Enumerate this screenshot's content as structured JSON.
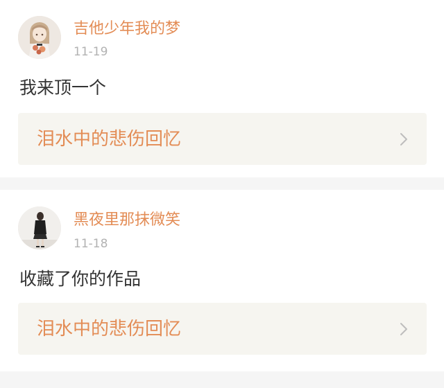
{
  "comments": [
    {
      "username": "吉他少年我的梦",
      "date": "11-19",
      "text": "我来顶一个",
      "work_title": "泪水中的悲伤回忆",
      "avatar_icon": "user-avatar-girl-icon"
    },
    {
      "username": "黑夜里那抹微笑",
      "date": "11-18",
      "text": "收藏了你的作品",
      "work_title": "泪水中的悲伤回忆",
      "avatar_icon": "user-avatar-person-icon"
    }
  ],
  "colors": {
    "accent": "#e38c55",
    "date": "#b2b2b2",
    "text": "#333333",
    "card_bg": "#ffffff",
    "link_bg": "#f6f5f0",
    "page_bg": "#f5f5f5",
    "chevron": "#bdbdbd"
  }
}
